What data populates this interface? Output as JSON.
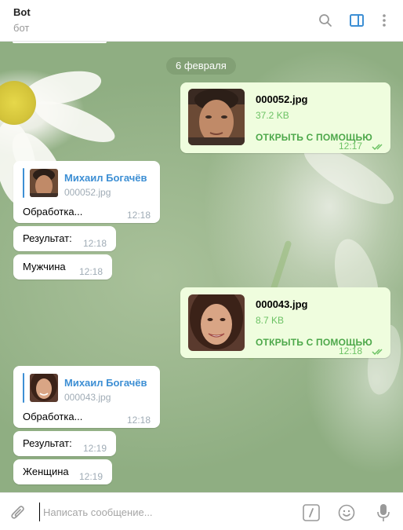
{
  "header": {
    "title": "Bot",
    "subtitle": "бот",
    "icons": [
      "search-icon",
      "sidebar-toggle-icon",
      "more-vertical-icon"
    ],
    "accent": "#3d8fd4"
  },
  "chat": {
    "date_separator": "6 февраля",
    "messages": [
      {
        "direction": "out",
        "type": "file",
        "file_name": "000052.jpg",
        "file_size": "37.2 KB",
        "action": "ОТКРЫТЬ С ПОМОЩЬЮ",
        "time": "12:17",
        "status": "read"
      },
      {
        "direction": "in",
        "type": "reply",
        "reply_author": "Михаил Богачёв",
        "reply_file": "000052.jpg",
        "text": "Обработка...",
        "time": "12:18"
      },
      {
        "direction": "in",
        "type": "text",
        "text": "Результат:",
        "time": "12:18"
      },
      {
        "direction": "in",
        "type": "text",
        "text": "Мужчина",
        "time": "12:18"
      },
      {
        "direction": "out",
        "type": "file",
        "file_name": "000043.jpg",
        "file_size": "8.7 KB",
        "action": "ОТКРЫТЬ С ПОМОЩЬЮ",
        "time": "12:18",
        "status": "read"
      },
      {
        "direction": "in",
        "type": "reply",
        "reply_author": "Михаил Богачёв",
        "reply_file": "000043.jpg",
        "text": "Обработка...",
        "time": "12:18"
      },
      {
        "direction": "in",
        "type": "text",
        "text": "Результат:",
        "time": "12:19"
      },
      {
        "direction": "in",
        "type": "text",
        "text": "Женщина",
        "time": "12:19"
      }
    ]
  },
  "composer": {
    "placeholder": "Написать сообщение...",
    "icons": [
      "attach-icon",
      "commands-icon",
      "emoji-icon",
      "microphone-icon"
    ]
  },
  "colors": {
    "outgoing_bubble": "#effdde",
    "incoming_bubble": "#ffffff",
    "link_green": "#4da84a",
    "date_pill": "#809d73"
  }
}
